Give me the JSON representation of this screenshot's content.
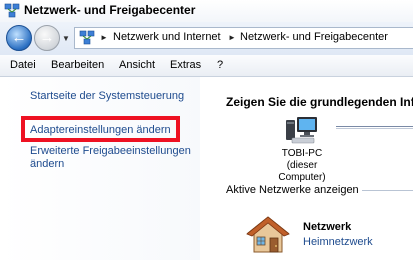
{
  "window": {
    "title": "Netzwerk- und Freigabecenter"
  },
  "navigation": {
    "breadcrumbs": [
      "Netzwerk und Internet",
      "Netzwerk- und Freigabecenter"
    ]
  },
  "menu": {
    "items": [
      "Datei",
      "Bearbeiten",
      "Ansicht",
      "Extras",
      "?"
    ]
  },
  "sidebar": {
    "links": [
      "Startseite der Systemsteuerung",
      "Adaptereinstellungen ändern",
      "Erweiterte Freigabeeinstellungen",
      "ändern"
    ],
    "highlight_color": "#ee1122"
  },
  "main": {
    "heading": "Zeigen Sie die grundlegenden Info",
    "computer": {
      "name": "TOBI-PC",
      "subtitle": "(dieser Computer)",
      "icon": "computer-icon"
    },
    "active_networks_label": "Aktive Netzwerke anzeigen",
    "network": {
      "name": "Netzwerk",
      "type": "Heimnetzwerk",
      "icon": "home-network-icon"
    }
  },
  "colors": {
    "link": "#1e4b8e",
    "accent": "#2a6fc2"
  }
}
